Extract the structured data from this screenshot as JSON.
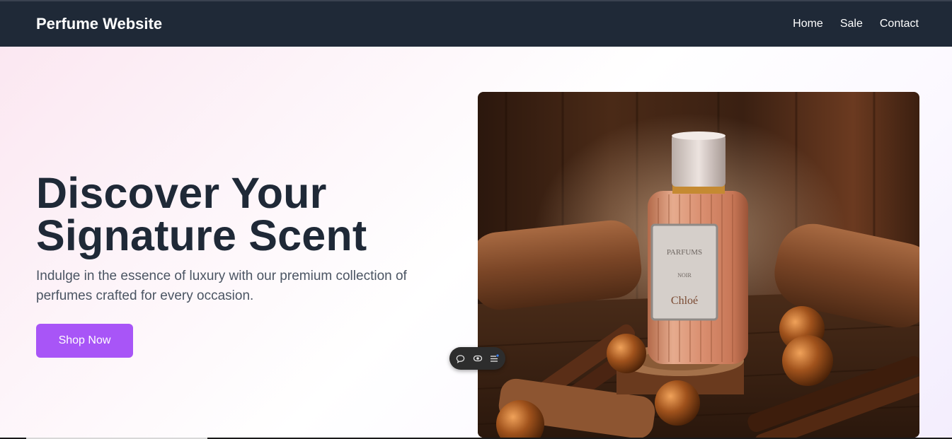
{
  "nav": {
    "brand": "Perfume Website",
    "links": [
      {
        "label": "Home"
      },
      {
        "label": "Sale"
      },
      {
        "label": "Contact"
      }
    ]
  },
  "hero": {
    "headline_line1": "Discover Your",
    "headline_line2": "Signature Scent",
    "subtitle": "Indulge in the essence of luxury with our premium collection of perfumes crafted for every occasion.",
    "cta_label": "Shop Now",
    "image": {
      "alt": "Perfume bottle on wooden stand",
      "bottle_label_brand": "Chloé"
    }
  },
  "floating_toolbar": {
    "icons": [
      "comment-icon",
      "eye-icon",
      "list-icon"
    ]
  },
  "colors": {
    "nav_bg": "#1f2937",
    "headline": "#1f2937",
    "subtitle": "#4b5563",
    "accent": "#a855f7"
  }
}
